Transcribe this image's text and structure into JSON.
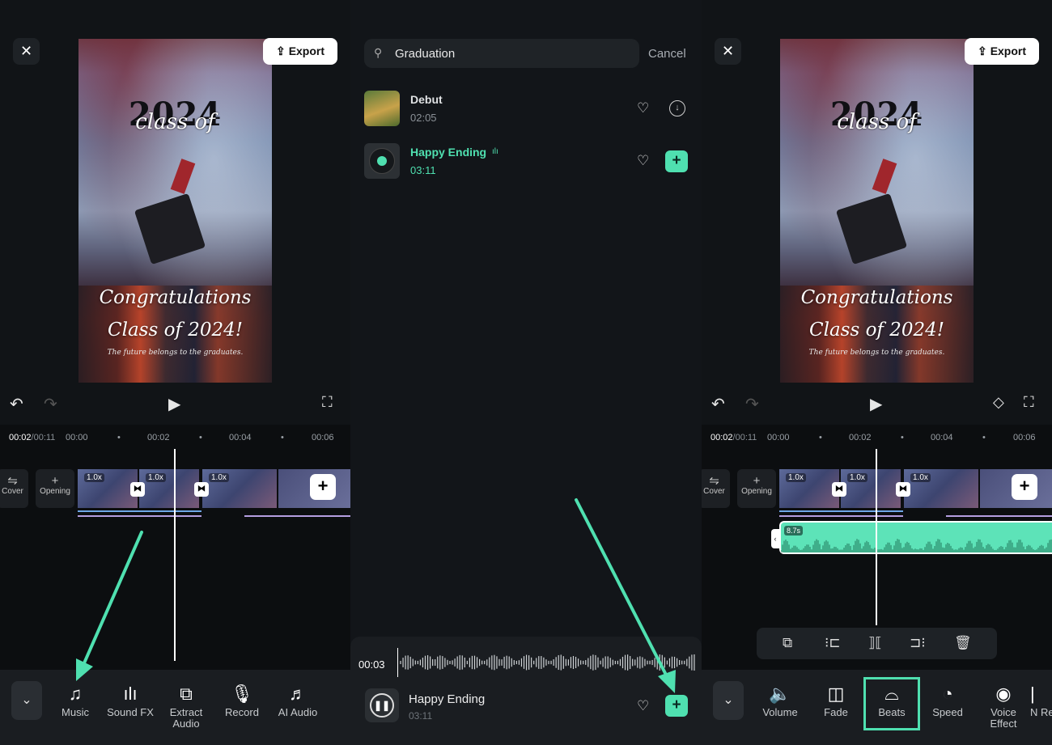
{
  "editor": {
    "close_icon": "✕",
    "export_label": "Export",
    "preview": {
      "year_text": "2024",
      "class_text": "class of",
      "congrats_line1": "Congratulations",
      "congrats_line2": "Class of 2024!",
      "tagline": "The future belongs to the graduates."
    },
    "timecode": "00:02",
    "duration": "/00:11",
    "ruler_ticks": [
      "00:00",
      "00:02",
      "00:04",
      "00:06"
    ],
    "cover_label": "Cover",
    "opening_label": "Opening",
    "speed_badge": "1.0x",
    "audio_clip_length": "8.7s"
  },
  "toolbar_left": {
    "items": [
      {
        "label": "Music",
        "icon": "music-note-icon"
      },
      {
        "label": "Sound FX",
        "icon": "sound-fx-icon"
      },
      {
        "label": "Extract Audio",
        "icon": "extract-audio-icon"
      },
      {
        "label": "Record",
        "icon": "microphone-icon"
      },
      {
        "label": "AI Audio",
        "icon": "ai-audio-icon"
      }
    ]
  },
  "music_search": {
    "query": "Graduation",
    "cancel_label": "Cancel",
    "tracks": [
      {
        "name": "Debut",
        "duration": "02:05"
      },
      {
        "name": "Happy Ending",
        "duration": "03:11"
      }
    ],
    "player": {
      "current_time": "00:03",
      "track_name": "Happy Ending",
      "track_duration": "03:11"
    }
  },
  "toolbar_right": {
    "items": [
      {
        "label": "Volume",
        "icon": "volume-icon"
      },
      {
        "label": "Fade",
        "icon": "fade-icon"
      },
      {
        "label": "Beats",
        "icon": "beats-icon"
      },
      {
        "label": "Speed",
        "icon": "speed-icon"
      },
      {
        "label": "Voice Effect",
        "icon": "voice-effect-icon"
      },
      {
        "label": "N Rec",
        "icon": "noise-reduction-icon"
      }
    ]
  },
  "colors": {
    "accent": "#4fe0b0",
    "annotation_arrow": "#4fe0b0",
    "audio_track": "#5de3b8"
  }
}
